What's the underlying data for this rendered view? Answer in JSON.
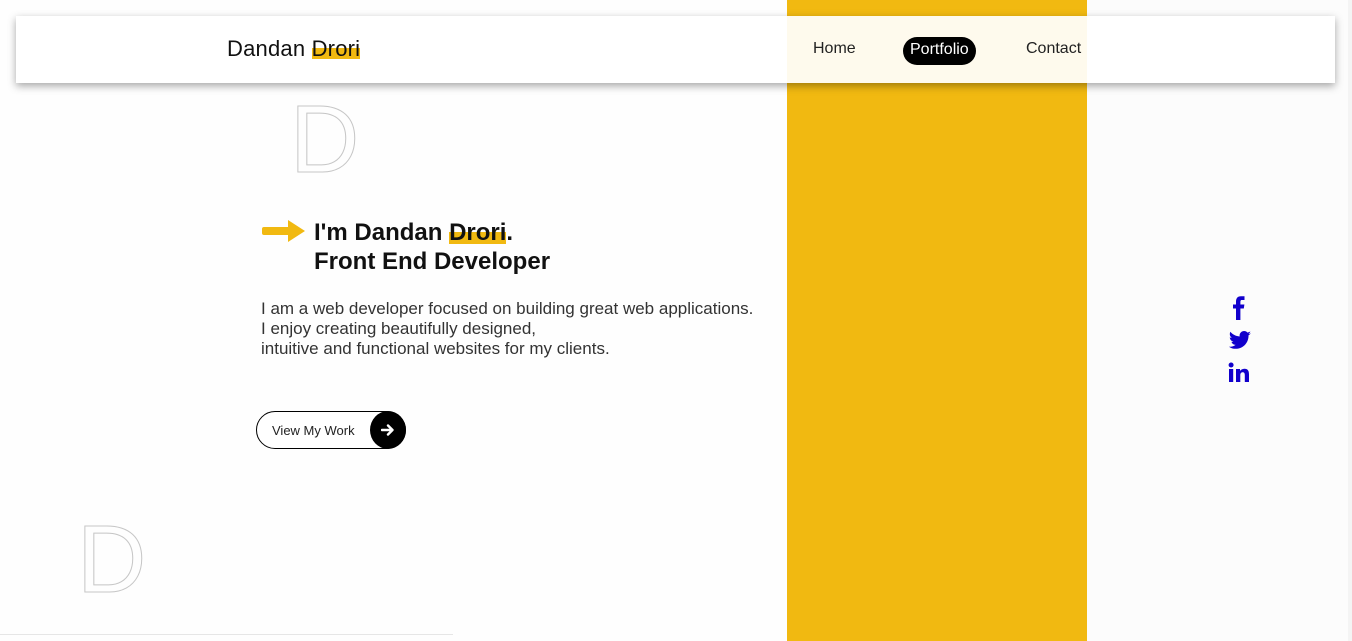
{
  "brand": {
    "first": "Dandan ",
    "last": "Drori"
  },
  "nav": {
    "home": "Home",
    "portfolio": "Portfolio",
    "contact": "Contact"
  },
  "decor": {
    "letter": "D"
  },
  "hero": {
    "greeting": "I'm Dandan ",
    "name_highlight": "Drori",
    "period": ".",
    "role": "Front End Developer",
    "description_lines": [
      "I am a web developer focused on building great web applications.",
      "I enjoy creating beautifully designed,",
      "intuitive and functional websites for my clients."
    ]
  },
  "cta": {
    "label": "View My Work",
    "icon": "arrow-right-icon"
  },
  "social": [
    {
      "name": "facebook-icon",
      "color": "#1100cc"
    },
    {
      "name": "twitter-icon",
      "color": "#1100cc"
    },
    {
      "name": "linkedin-icon",
      "color": "#1100cc"
    }
  ],
  "colors": {
    "accent": "#f1b911",
    "social": "#1100cc",
    "dark": "#000000"
  }
}
